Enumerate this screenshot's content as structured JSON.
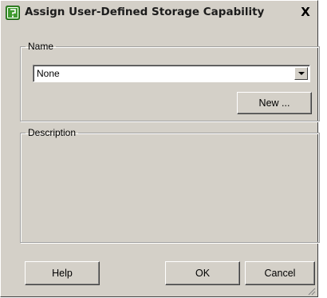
{
  "window": {
    "title": "Assign User-Defined Storage Capability",
    "close_label": "X"
  },
  "name_group": {
    "label": "Name",
    "selected_value": "None",
    "new_button_label": "New ..."
  },
  "description_group": {
    "label": "Description"
  },
  "footer": {
    "help_label": "Help",
    "ok_label": "OK",
    "cancel_label": "Cancel"
  },
  "colors": {
    "dialog_face": "#d4d0c8",
    "icon_green": "#3f9a2e"
  }
}
